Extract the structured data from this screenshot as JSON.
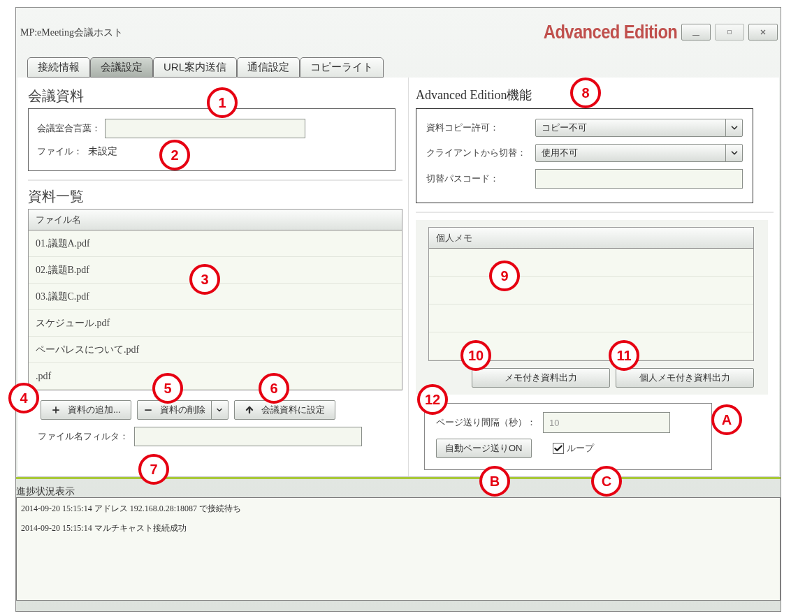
{
  "window": {
    "title": "MP:eMeeting会議ホスト",
    "edition": "Advanced Edition"
  },
  "tabs": [
    {
      "label": "接続情報",
      "selected": false
    },
    {
      "label": "会議設定",
      "selected": true
    },
    {
      "label": "URL案内送信",
      "selected": false
    },
    {
      "label": "通信設定",
      "selected": false
    },
    {
      "label": "コピーライト",
      "selected": false
    }
  ],
  "meeting_material": {
    "heading": "会議資料",
    "passphrase_label": "会議室合言葉：",
    "file_label": "ファイル：",
    "file_value": "未設定"
  },
  "material_list": {
    "heading": "資料一覧",
    "column": "ファイル名",
    "rows": [
      "01.議題A.pdf",
      "02.議題B.pdf",
      "03.議題C.pdf",
      "スケジュール.pdf",
      "ペーパレスについて.pdf",
      ".pdf"
    ],
    "buttons": [
      {
        "kind": "add",
        "label": "資料の追加..."
      },
      {
        "kind": "delete",
        "label": "資料の削除"
      },
      {
        "kind": "set",
        "label": "会議資料に設定"
      }
    ],
    "filter_label": "ファイル名フィルタ："
  },
  "advanced": {
    "heading": "Advanced Edition機能",
    "fields": [
      {
        "kind": "select",
        "label": "資料コピー許可：",
        "value": "コピー不可"
      },
      {
        "kind": "select",
        "label": "クライアントから切替：",
        "value": "使用不可"
      },
      {
        "kind": "text",
        "label": "切替パスコード："
      }
    ]
  },
  "memo": {
    "column": "個人メモ",
    "buttons": [
      "メモ付き資料出力",
      "個人メモ付き資料出力"
    ]
  },
  "slideshow": {
    "interval_label": "ページ送り間隔（秒）：",
    "interval_value": "10",
    "auto_button": "自動ページ送りON",
    "loop": {
      "label": "ループ",
      "checked": true
    }
  },
  "progress": {
    "heading": "進捗状況表示",
    "lines": [
      "2014-09-20 15:15:14 アドレス 192.168.0.28:18087 で接続待ち",
      "2014-09-20 15:15:14 マルチキャスト接続成功"
    ]
  },
  "callouts": [
    "1",
    "2",
    "3",
    "4",
    "5",
    "6",
    "7",
    "8",
    "9",
    "10",
    "11",
    "12",
    "A",
    "B",
    "C"
  ]
}
